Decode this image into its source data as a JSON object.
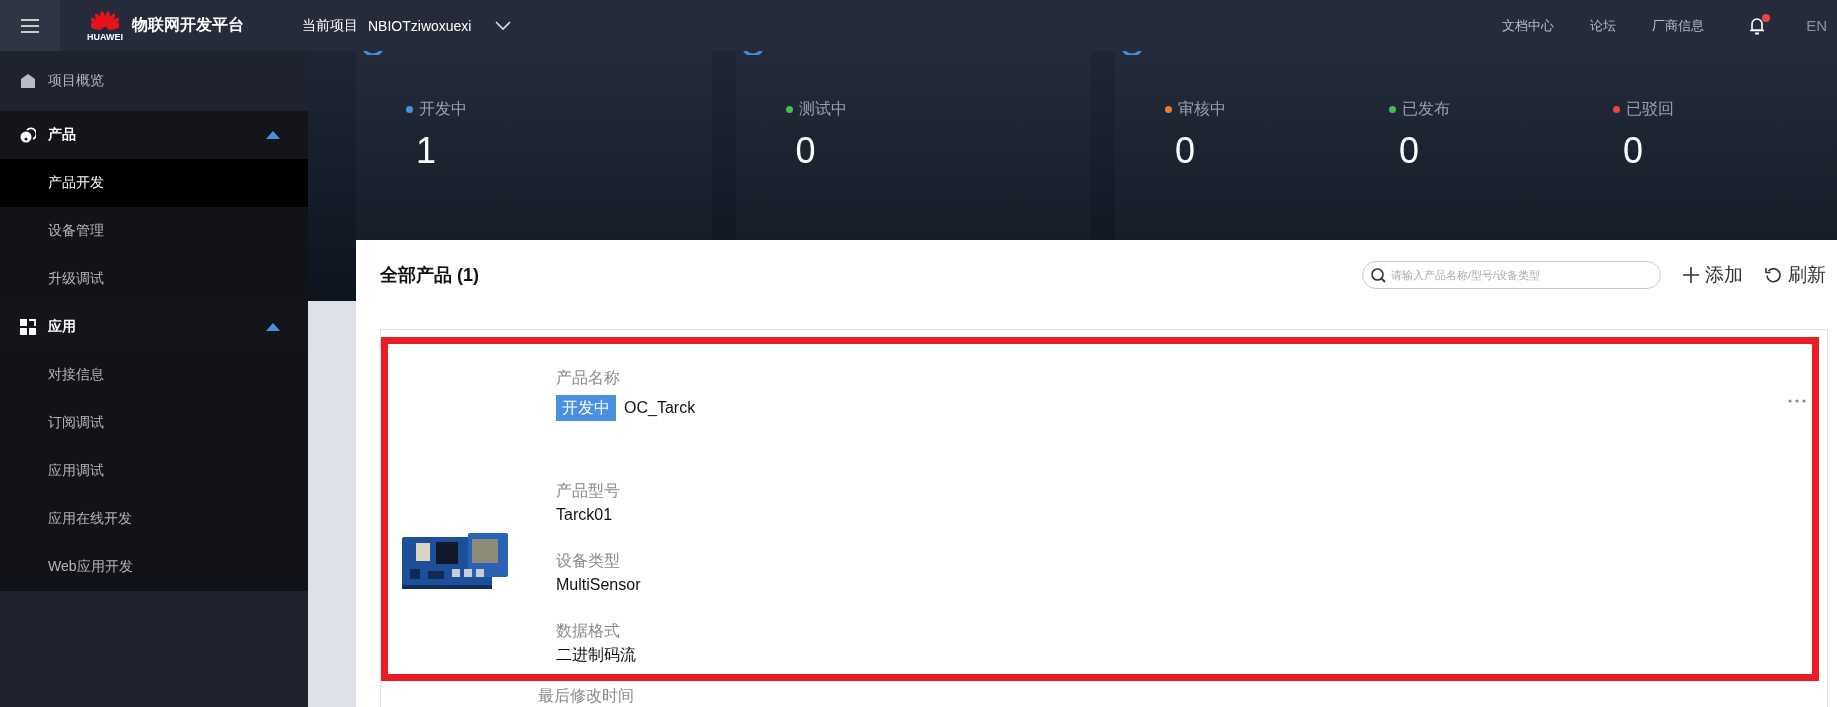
{
  "topbar": {
    "logo_text": "HUAWEI",
    "brand": "物联网开发平台",
    "project_label": "当前项目",
    "project_name": "NBIOTziwoxuexi",
    "links": [
      "文档中心",
      "论坛",
      "厂商信息"
    ],
    "notifications_unread": true,
    "language": "EN"
  },
  "sidebar": {
    "items": [
      {
        "kind": "link",
        "label": "项目概览",
        "selected": false
      },
      {
        "kind": "group",
        "label": "产品",
        "expanded": true,
        "children": [
          {
            "label": "产品开发",
            "selected": true
          },
          {
            "label": "设备管理",
            "selected": false
          },
          {
            "label": "升级调试",
            "selected": false
          }
        ]
      },
      {
        "kind": "group",
        "label": "应用",
        "expanded": true,
        "children": [
          {
            "label": "对接信息",
            "selected": false
          },
          {
            "label": "订阅调试",
            "selected": false
          },
          {
            "label": "应用调试",
            "selected": false
          },
          {
            "label": "应用在线开发",
            "selected": false
          },
          {
            "label": "Web应用开发",
            "selected": false
          }
        ]
      }
    ]
  },
  "stat_cards": [
    {
      "stats": [
        {
          "label": "开发中",
          "value": "1",
          "color": "#4a90e2"
        }
      ]
    },
    {
      "stats": [
        {
          "label": "测试中",
          "value": "0",
          "color": "#3fbf4f"
        }
      ]
    },
    {
      "stats": [
        {
          "label": "审核中",
          "value": "0",
          "color": "#f07a2a"
        },
        {
          "label": "已发布",
          "value": "0",
          "color": "#3fbf4f"
        },
        {
          "label": "已驳回",
          "value": "0",
          "color": "#e84646"
        }
      ]
    }
  ],
  "products_panel": {
    "title": "全部产品 (1)",
    "search": {
      "placeholder": "请输入产品名称/型号/设备类型"
    },
    "actions": [
      {
        "kind": "add",
        "label": "添加"
      },
      {
        "kind": "refresh",
        "label": "刷新"
      }
    ],
    "products": [
      {
        "highlighted": true,
        "name_label": "产品名称",
        "status": "开发中",
        "name": "OC_Tarck",
        "fields": [
          {
            "label": "产品型号",
            "value": "Tarck01"
          },
          {
            "label": "设备类型",
            "value": "MultiSensor"
          },
          {
            "label": "数据格式",
            "value": "二进制码流"
          }
        ],
        "last_modified_label": "最后修改时间"
      }
    ]
  }
}
